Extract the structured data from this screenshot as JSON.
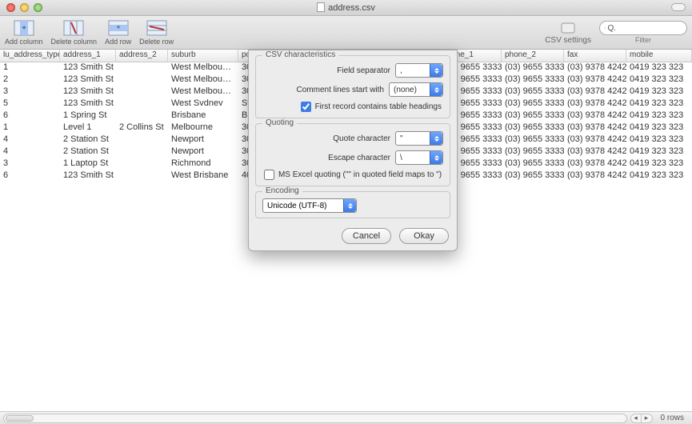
{
  "title": "address.csv",
  "toolbar": {
    "add_column": "Add column",
    "delete_column": "Delete column",
    "add_row": "Add row",
    "delete_row": "Delete row",
    "csv_settings": "CSV settings",
    "filter": "Filter",
    "search_placeholder": ""
  },
  "columns": [
    "lu_address_type_i",
    "address_1",
    "address_2",
    "suburb",
    "pos",
    "phone_1",
    "phone_2",
    "fax",
    "mobile"
  ],
  "rows": [
    {
      "c0": "1",
      "c1": "123 Smith St",
      "c2": "",
      "c3": "West Melbou…",
      "c4": "30(",
      "c5": "(03) 9655 3333",
      "c6": "(03) 9655 3333",
      "c7": "(03) 9378 4242",
      "c8": "0419 323 323"
    },
    {
      "c0": "2",
      "c1": "123 Smith St",
      "c2": "",
      "c3": "West Melbou…",
      "c4": "30(",
      "c5": "(03) 9655 3333",
      "c6": "(03) 9655 3333",
      "c7": "(03) 9378 4242",
      "c8": "0419 323 323"
    },
    {
      "c0": "3",
      "c1": "123 Smith St",
      "c2": "",
      "c3": "West Melbou…",
      "c4": "30(",
      "c5": "(03) 9655 3333",
      "c6": "(03) 9655 3333",
      "c7": "(03) 9378 4242",
      "c8": "0419 323 323"
    },
    {
      "c0": "5",
      "c1": "123 Smith St",
      "c2": "",
      "c3": "West Svdnev",
      "c4": "Syc",
      "c5": "(03) 9655 3333",
      "c6": "(03) 9655 3333",
      "c7": "(03) 9378 4242",
      "c8": "0419 323 323"
    },
    {
      "c0": "6",
      "c1": "1 Spring St",
      "c2": "",
      "c3": "Brisbane",
      "c4": "Bri",
      "c5": "(03) 9655 3333",
      "c6": "(03) 9655 3333",
      "c7": "(03) 9378 4242",
      "c8": "0419 323 323"
    },
    {
      "c0": "1",
      "c1": "Level 1",
      "c2": "2 Collins St",
      "c3": "Melbourne",
      "c4": "30(",
      "c5": "(03) 9655 3333",
      "c6": "(03) 9655 3333",
      "c7": "(03) 9378 4242",
      "c8": "0419 323 323"
    },
    {
      "c0": "4",
      "c1": "2 Station St",
      "c2": "",
      "c3": "Newport",
      "c4": "30(",
      "c5": "(03) 9655 3333",
      "c6": "(03) 9655 3333",
      "c7": "(03) 9378 4242",
      "c8": "0419 323 323"
    },
    {
      "c0": "4",
      "c1": "2 Station St",
      "c2": "",
      "c3": "Newport",
      "c4": "30(",
      "c5": "(03) 9655 3333",
      "c6": "(03) 9655 3333",
      "c7": "(03) 9378 4242",
      "c8": "0419 323 323"
    },
    {
      "c0": "3",
      "c1": "1 Laptop St",
      "c2": "",
      "c3": "Richmond",
      "c4": "30(",
      "c5": "(03) 9655 3333",
      "c6": "(03) 9655 3333",
      "c7": "(03) 9378 4242",
      "c8": "0419 323 323"
    },
    {
      "c0": "6",
      "c1": "123 Smith St",
      "c2": "",
      "c3": "West Brisbane",
      "c4": "40(",
      "c5": "(03) 9655 3333",
      "c6": "(03) 9655 3333",
      "c7": "(03) 9378 4242",
      "c8": "0419 323 323"
    }
  ],
  "dialog": {
    "group1": "CSV characteristics",
    "field_separator_label": "Field separator",
    "field_separator_value": ",",
    "comment_label": "Comment lines start with",
    "comment_value": "(none)",
    "first_record_label": "First record contains table headings",
    "first_record_checked": true,
    "group2": "Quoting",
    "quote_char_label": "Quote character",
    "quote_char_value": "\"",
    "escape_char_label": "Escape character",
    "escape_char_value": "\\",
    "excel_label": "MS Excel quoting (\"\" in quoted field maps to \")",
    "excel_checked": false,
    "group3": "Encoding",
    "encoding_value": "Unicode (UTF-8)",
    "cancel": "Cancel",
    "okay": "Okay"
  },
  "status": "0 rows"
}
